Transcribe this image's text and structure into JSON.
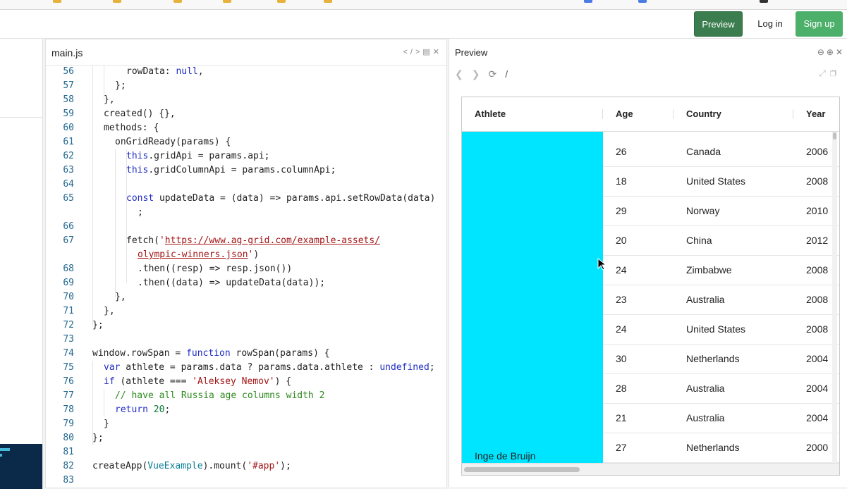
{
  "header": {
    "preview_label": "Preview",
    "login_label": "Log in",
    "signup_label": "Sign up"
  },
  "editor": {
    "filename": "main.js"
  },
  "code_lines": [
    {
      "n": "56"
    },
    {
      "n": "57"
    },
    {
      "n": "58"
    },
    {
      "n": "59"
    },
    {
      "n": "60"
    },
    {
      "n": "61"
    },
    {
      "n": "62"
    },
    {
      "n": "63"
    },
    {
      "n": "64"
    },
    {
      "n": "65"
    },
    {
      "n": ""
    },
    {
      "n": "66"
    },
    {
      "n": "67"
    },
    {
      "n": ""
    },
    {
      "n": "68"
    },
    {
      "n": "69"
    },
    {
      "n": "70"
    },
    {
      "n": "71"
    },
    {
      "n": "72"
    },
    {
      "n": "73"
    },
    {
      "n": "74"
    },
    {
      "n": "75"
    },
    {
      "n": "76"
    },
    {
      "n": "77"
    },
    {
      "n": "78"
    },
    {
      "n": "79"
    },
    {
      "n": "80"
    },
    {
      "n": "81"
    },
    {
      "n": "82"
    },
    {
      "n": "83"
    }
  ],
  "code": {
    "l56": "rowData: null,",
    "l57": "};",
    "l58": "},",
    "l59": "created() {},",
    "l60": "methods: {",
    "l61": "onGridReady(params) {",
    "l62_kw": "this",
    "l62_rest": ".gridApi = params.api;",
    "l63_kw": "this",
    "l63_rest": ".gridColumnApi = params.columnApi;",
    "l65_kw": "const",
    "l65_rest": " updateData = (data) => params.api.setRowData(data)",
    "l65_cont": ";",
    "l67_a": "fetch(",
    "l67_q": "'",
    "l67_url1": "https://www.ag-grid.com/example-assets/",
    "l67_url2": "olympic-winners.json",
    "l67_q2": "'",
    "l67_end": ")",
    "l68": ".then((resp) => resp.json())",
    "l69": ".then((data) => updateData(data));",
    "l70": "},",
    "l71": "},",
    "l72": "};",
    "l74_a": "window.rowSpan = ",
    "l74_kw": "function",
    "l74_b": " rowSpan(params) {",
    "l75_kw": "var",
    "l75_a": " athlete = params.data ? params.data.athlete : ",
    "l75_kw2": "undefined",
    "l75_b": ";",
    "l76_kw": "if",
    "l76_a": " (athlete === ",
    "l76_str": "'Aleksey Nemov'",
    "l76_b": ") {",
    "l77": "// have all Russia age columns width 2",
    "l78_kw": "return",
    "l78_sp": " ",
    "l78_num": "20",
    "l78_b": ";",
    "l79": "}",
    "l80": "};",
    "l82_a": "createApp(",
    "l82_cls": "VueExample",
    "l82_b": ").mount(",
    "l82_str": "'#app'",
    "l82_c": ");"
  },
  "preview": {
    "title": "Preview",
    "path": "/"
  },
  "grid": {
    "columns": [
      "Athlete",
      "Age",
      "Country",
      "Year"
    ],
    "span_athlete": "Inge de Bruijn",
    "rows": [
      {
        "age": "26",
        "country": "Canada",
        "year": "2006"
      },
      {
        "age": "18",
        "country": "United States",
        "year": "2008"
      },
      {
        "age": "29",
        "country": "Norway",
        "year": "2010"
      },
      {
        "age": "20",
        "country": "China",
        "year": "2012"
      },
      {
        "age": "24",
        "country": "Zimbabwe",
        "year": "2008"
      },
      {
        "age": "23",
        "country": "Australia",
        "year": "2008"
      },
      {
        "age": "24",
        "country": "United States",
        "year": "2008"
      },
      {
        "age": "30",
        "country": "Netherlands",
        "year": "2004"
      },
      {
        "age": "28",
        "country": "Australia",
        "year": "2004"
      },
      {
        "age": "21",
        "country": "Australia",
        "year": "2004"
      },
      {
        "age": "27",
        "country": "Netherlands",
        "year": "2000"
      }
    ]
  },
  "colors": {
    "span_highlight": "#00e5ff",
    "preview_button": "#3b7d4f",
    "signup_button": "#4caf6a"
  }
}
